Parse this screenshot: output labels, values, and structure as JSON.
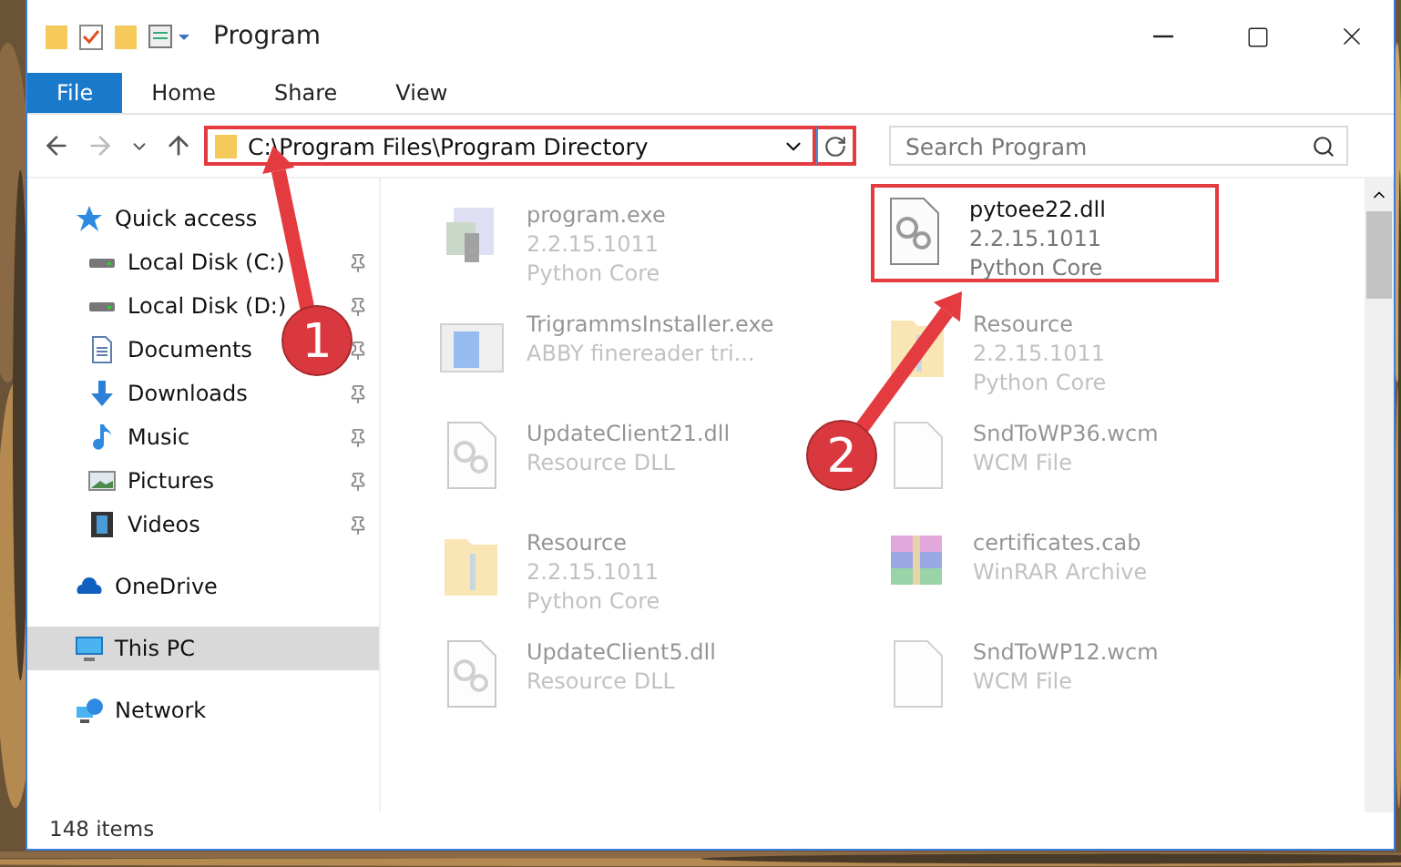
{
  "window": {
    "title": "Program"
  },
  "ribbon_tabs": [
    {
      "label": "File",
      "selected": true
    },
    {
      "label": "Home",
      "selected": false
    },
    {
      "label": "Share",
      "selected": false
    },
    {
      "label": "View",
      "selected": false
    }
  ],
  "address": {
    "path": "C:\\Program Files\\Program Directory",
    "highlighted": true
  },
  "search": {
    "placeholder": "Search Program"
  },
  "sidebar": {
    "items": [
      {
        "label": "Quick access",
        "kind": "star",
        "selected": false,
        "children": [
          {
            "label": "Local Disk (C:)",
            "kind": "drive",
            "pinned": true,
            "selected": false
          },
          {
            "label": "Local Disk (D:)",
            "kind": "drive",
            "pinned": true,
            "selected": false
          },
          {
            "label": "Documents",
            "kind": "document",
            "pinned": true,
            "selected": false
          },
          {
            "label": "Downloads",
            "kind": "download",
            "pinned": true,
            "selected": false
          },
          {
            "label": "Music",
            "kind": "music",
            "pinned": true,
            "selected": false
          },
          {
            "label": "Pictures",
            "kind": "pictures",
            "pinned": true,
            "selected": false
          },
          {
            "label": "Videos",
            "kind": "videos",
            "pinned": true,
            "selected": false
          }
        ]
      },
      {
        "label": "OneDrive",
        "kind": "cloud",
        "selected": false
      },
      {
        "label": "This PC",
        "kind": "monitor",
        "selected": true
      },
      {
        "label": "Network",
        "kind": "network",
        "selected": false
      }
    ]
  },
  "files": [
    {
      "name": "program.exe",
      "details": [
        "2.2.15.1011",
        "Python Core"
      ],
      "kind": "exe",
      "highlighted": false
    },
    {
      "name": "pytoee22.dll",
      "details": [
        "2.2.15.1011",
        "Python Core"
      ],
      "kind": "dll",
      "highlighted": true
    },
    {
      "name": "TrigrammsInstaller.exe",
      "details": [
        "ABBY finereader tri..."
      ],
      "kind": "installer",
      "highlighted": false
    },
    {
      "name": "Resource",
      "details": [
        "2.2.15.1011",
        "Python Core"
      ],
      "kind": "folder",
      "highlighted": false
    },
    {
      "name": "UpdateClient21.dll",
      "details": [
        "Resource DLL"
      ],
      "kind": "dll",
      "highlighted": false
    },
    {
      "name": "SndToWP36.wcm",
      "details": [
        "WCM File"
      ],
      "kind": "blank",
      "highlighted": false
    },
    {
      "name": "Resource",
      "details": [
        "2.2.15.1011",
        "Python Core"
      ],
      "kind": "folder",
      "highlighted": false
    },
    {
      "name": "certificates.cab",
      "details": [
        "WinRAR Archive"
      ],
      "kind": "archive",
      "highlighted": false
    },
    {
      "name": "UpdateClient5.dll",
      "details": [
        "Resource DLL"
      ],
      "kind": "dll",
      "highlighted": false
    },
    {
      "name": "SndToWP12.wcm",
      "details": [
        "WCM File"
      ],
      "kind": "blank",
      "highlighted": false
    }
  ],
  "callouts": [
    {
      "label": "1"
    },
    {
      "label": "2"
    }
  ],
  "status_bar": {
    "count": "148 items"
  }
}
